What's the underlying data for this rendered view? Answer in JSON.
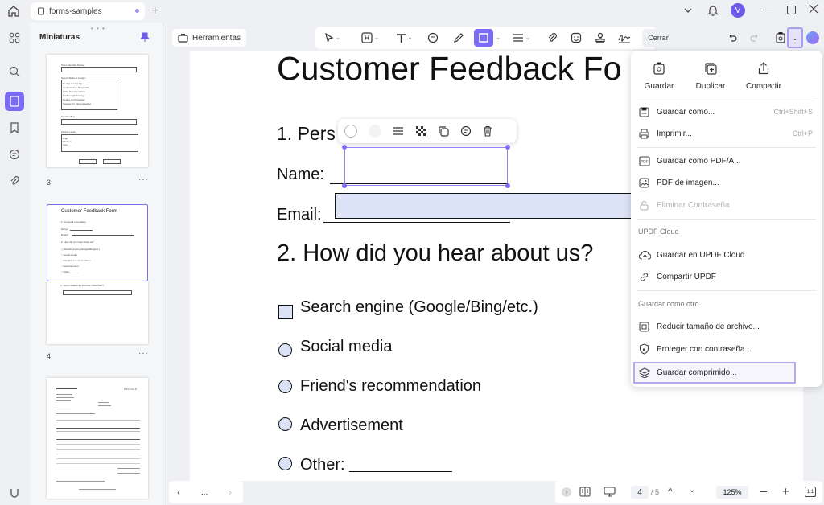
{
  "tabbar": {
    "tab_label": "forms-samples"
  },
  "user": {
    "avatar_letter": "V"
  },
  "thumbs": {
    "title": "Miniaturas",
    "pages": [
      {
        "number": "3"
      },
      {
        "number": "4",
        "heading": "Customer Feedback Form"
      },
      {
        "number": "",
        "heading": "INVOICE"
      }
    ]
  },
  "toolbar": {
    "herramientas_label": "Herramientas",
    "cerrar_label": "Cerrar"
  },
  "document": {
    "title": "Customer Feedback Fo",
    "section1": "1. Pers",
    "name_label": "Name: ",
    "email_label": "Email: ",
    "section2": "2. How did you hear about us?",
    "options": [
      "Search engine (Google/Bing/etc.)",
      "Social media",
      "Friend's recommendation",
      "Advertisement",
      "Other: "
    ]
  },
  "menu": {
    "top_actions": [
      "Guardar",
      "Duplicar",
      "Compartir"
    ],
    "items": [
      {
        "label": "Guardar como...",
        "shortcut": "Ctrl+Shift+S"
      },
      {
        "label": "Imprimir...",
        "shortcut": "Ctrl+P"
      },
      {
        "label": "Guardar como PDF/A..."
      },
      {
        "label": "PDF de imagen..."
      },
      {
        "label": "Eliminar Contraseña"
      }
    ],
    "cloud_section": "UPDF Cloud",
    "cloud_items": [
      "Guardar en UPDF Cloud",
      "Compartir UPDF"
    ],
    "other_section": "Guardar como otro",
    "other_items": [
      "Reducir tamaño de archivo...",
      "Proteger con contraseña...",
      "Guardar comprimido..."
    ]
  },
  "bottombar": {
    "page_current": "4",
    "page_total": "/ 5",
    "zoom": "125%",
    "more": "..."
  }
}
